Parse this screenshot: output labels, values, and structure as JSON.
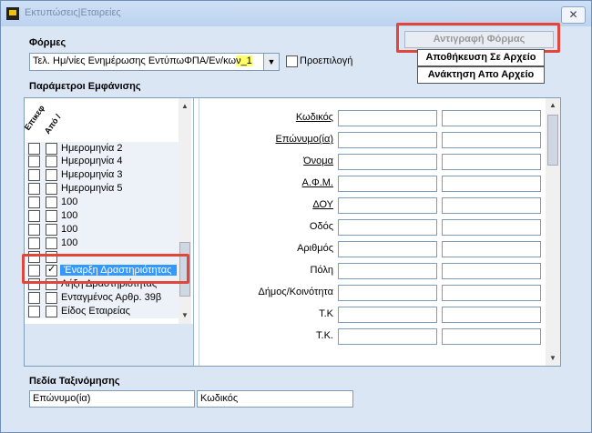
{
  "window": {
    "title": "Εκτυπώσεις|Εταιρείες",
    "close_label": "✕"
  },
  "forms": {
    "label": "Φόρμες",
    "selected_prefix": "Τελ. Ημ/νίες  Ενημέρωσης ΕντύπωΦΠΑ/Εν/κω",
    "selected_highlight": "ν_1",
    "default_label": "Προεπιλογή"
  },
  "buttons": {
    "copy_form": "Αντιγραφή Φόρμας",
    "save_to_file": "Αποθήκευση Σε Αρχείο",
    "load_from_file": "Ανάκτηση Απο Αρχείο"
  },
  "display_params": {
    "label": "Παράμετροι Εμφάνισης",
    "col_headers": [
      "Επικεφ",
      "Από /"
    ],
    "items": [
      {
        "label": "Ημερομηνία 2",
        "c1": false,
        "c2": false
      },
      {
        "label": "Ημερομηνία 4",
        "c1": false,
        "c2": false
      },
      {
        "label": "Ημερομηνία 3",
        "c1": false,
        "c2": false
      },
      {
        "label": "Ημερομηνία 5",
        "c1": false,
        "c2": false
      },
      {
        "label": "100",
        "c1": false,
        "c2": false
      },
      {
        "label": "100",
        "c1": false,
        "c2": false
      },
      {
        "label": "100",
        "c1": false,
        "c2": false
      },
      {
        "label": "100",
        "c1": false,
        "c2": false
      },
      {
        "label": "",
        "c1": false,
        "c2": false
      },
      {
        "label": "Έναρξη Δραστηριότητας",
        "c1": false,
        "c2": true,
        "selected": true
      },
      {
        "label": "Λήξη Δραστηριότητας",
        "c1": false,
        "c2": false
      },
      {
        "label": "Ενταγμένος Αρθρ. 39β",
        "c1": false,
        "c2": false
      },
      {
        "label": "Είδος Εταιρείας",
        "c1": false,
        "c2": false
      }
    ]
  },
  "fields": [
    {
      "label": "Κωδικός",
      "underline": true
    },
    {
      "label": "Επώνυμο(ία)",
      "underline": true
    },
    {
      "label": "Όνομα",
      "underline": true
    },
    {
      "label": "Α.Φ.Μ.",
      "underline": true
    },
    {
      "label": "ΔΟΥ",
      "underline": true
    },
    {
      "label": "Οδός",
      "underline": false
    },
    {
      "label": "Αριθμός",
      "underline": false
    },
    {
      "label": "Πόλη",
      "underline": false
    },
    {
      "label": "Δήμος/Κοινότητα",
      "underline": false
    },
    {
      "label": "Τ.Κ",
      "underline": false
    },
    {
      "label": "Τ.Κ.",
      "underline": false
    }
  ],
  "sorting": {
    "label": "Πεδία Ταξινόμησης",
    "field1": "Επώνυμο(ία)",
    "field2": "Κωδικός"
  },
  "colors": {
    "highlight_red": "#e2463a",
    "selection_blue": "#3399ff",
    "window_bg": "#dbe6f5"
  }
}
